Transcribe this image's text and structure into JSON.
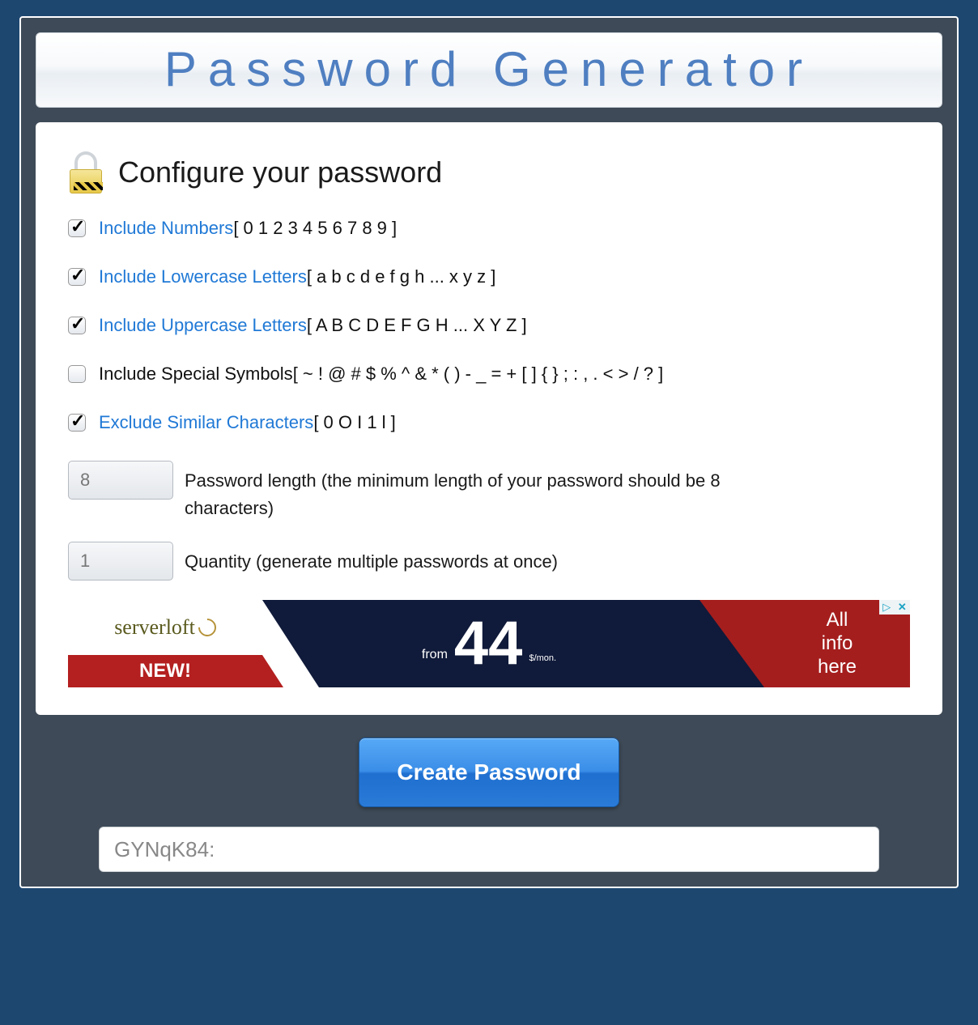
{
  "title": "Password Generator",
  "config": {
    "heading": "Configure your password",
    "options": [
      {
        "key": "numbers",
        "label": "Include Numbers",
        "desc": "[ 0 1 2 3 4 5 6 7 8 9 ]",
        "checked": true
      },
      {
        "key": "lowercase",
        "label": "Include Lowercase Letters",
        "desc": "[ a b c d e f g h ... x y z ]",
        "checked": true
      },
      {
        "key": "uppercase",
        "label": "Include Uppercase Letters",
        "desc": "[ A B C D E F G H ... X Y Z ]",
        "checked": true
      },
      {
        "key": "symbols",
        "label": "Include Special Symbols",
        "desc": "[ ~ ! @ # $ % ^ & * ( ) - _ = + [ ] { } ; : , . < > / ? ]",
        "checked": false
      },
      {
        "key": "similar",
        "label": "Exclude Similar Characters",
        "desc": "[ 0 O I 1 l ]",
        "checked": true
      }
    ],
    "length": {
      "value": "8",
      "label": "Password length (the minimum length of your password should be 8 characters)"
    },
    "quantity": {
      "value": "1",
      "label": "Quantity (generate multiple passwords at once)"
    }
  },
  "ad": {
    "brand": "serverloft",
    "new_badge": "NEW!",
    "from": "from",
    "price": "44",
    "unit": "$/mon.",
    "right1": "All",
    "right2": "info",
    "right3": "here"
  },
  "action": {
    "button": "Create Password"
  },
  "result": {
    "value": "GYNqK84:"
  }
}
